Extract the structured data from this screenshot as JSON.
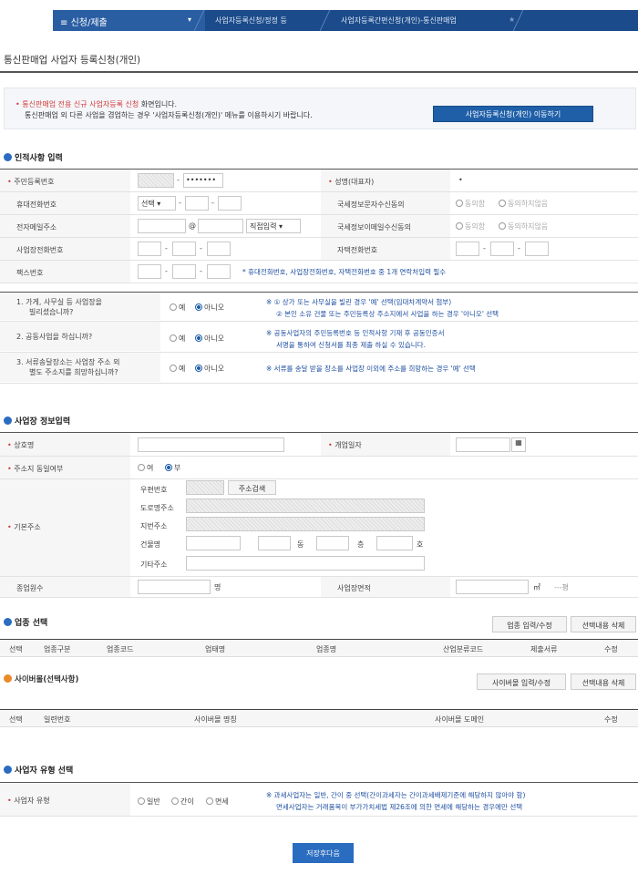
{
  "nav": {
    "menu": "신청/제출",
    "crumb1": "사업자등록신청/정정 등",
    "crumb2": "사업자등록간편신청(개인)-통신판매업"
  },
  "page_title": "통신판매업 사업자 등록신청(개인)",
  "notice": {
    "red": "• 통신판매업 전용 신규 사업자등록 신청",
    "l1_rest": " 화면입니다.",
    "l2": "통신판매업 외 다른 사업을 겸업하는 경우 '사업자등록신청(개인)' 메뉴를 이용하시기 바랍니다.",
    "button": "사업자등록신청(개인) 이동하기"
  },
  "personal": {
    "section": "인적사항 입력",
    "rrn_label": "주민등록번호",
    "rrn_masked": "•••••••",
    "name_label": "성명(대표자)",
    "name_value": "•",
    "mobile_label": "휴대전화번호",
    "mobile_select": "선택",
    "sms_label": "국세정보문자수신동의",
    "agree": "동의함",
    "disagree": "동의하지않음",
    "email_label": "전자메일주소",
    "at": "@",
    "email_select": "직접입력",
    "email_consent_label": "국세정보이메일수신동의",
    "biz_phone_label": "사업장전화번호",
    "home_phone_label": "자택전화번호",
    "fax_label": "팩스번호",
    "phone_note": "* 휴대전화번호, 사업장전화번호, 자택전화번호 중 1개 연락처입력 필수"
  },
  "questions": [
    {
      "q1": "1. 가게, 사무실 등 사업장을",
      "q2": "빌리셨습니까?",
      "yes": "예",
      "no": "아니오",
      "n1": "※ ① 상가 또는 사무실을 빌린 경우 '예' 선택(임대차계약서 첨부)",
      "n2": "② 본인 소유 건물 또는 주민등록상 주소지에서 사업을 하는 경우 '아니오' 선택"
    },
    {
      "q1": "2. 공동사업을 하십니까?",
      "q2": "",
      "yes": "예",
      "no": "아니오",
      "n1": "※ 공동사업자의 주민등록번호 등 인적사항 기재 후 공동인증서",
      "n2": "서명을 통하여 신청서를 최종 제출 하실 수 있습니다."
    },
    {
      "q1": "3. 서류송달장소는 사업장 주소 외",
      "q2": "별도 주소지를 희망하십니까?",
      "yes": "예",
      "no": "아니오",
      "n1": "※ 서류를 송달 받을 장소를 사업장 이외에 주소를 희망하는 경우 '예' 선택",
      "n2": ""
    }
  ],
  "business": {
    "section": "사업장 정보입력",
    "name_label": "상호명",
    "open_label": "개업일자",
    "addr_same_label": "주소지 동일여부",
    "yes": "여",
    "no": "부",
    "addr_label": "기본주소",
    "zip": "우편번호",
    "zip_btn": "주소검색",
    "road": "도로명주소",
    "lot": "지번주소",
    "building": "건물명",
    "dong": "동",
    "floor": "층",
    "ho": "호",
    "other": "기타주소",
    "emp_label": "종업원수",
    "person": "명",
    "area_label": "사업장면적",
    "sqm": "㎡",
    "pyeong": "---평"
  },
  "industry": {
    "section": "업종 선택",
    "btn_input": "업종 입력/수정",
    "btn_delete": "선택내용 삭제",
    "cols": [
      "선택",
      "업종구분",
      "업종코드",
      "업태명",
      "업종명",
      "산업분류코드",
      "제출서류",
      "수정"
    ]
  },
  "cybermall": {
    "section": "사이버몰(선택사항)",
    "btn_input": "사이버몰 입력/수정",
    "btn_delete": "선택내용 삭제",
    "cols": [
      "선택",
      "일련번호",
      "사이버몰 명칭",
      "사이버몰 도메인",
      "수정"
    ]
  },
  "biz_type": {
    "section": "사업자 유형 선택",
    "label": "사업자 유형",
    "opts": [
      "일반",
      "간이",
      "면세"
    ],
    "n1": "※ 과세사업자는 일반, 간이 중 선택(간이과세자는 간이과세배제기준에 해당하지 않아야 함)",
    "n2": "면세사업자는 거래품목이 부가가치세법 제26조에 의한 면세에 해당하는 경우에만 선택"
  },
  "save_button": "저장후다음"
}
